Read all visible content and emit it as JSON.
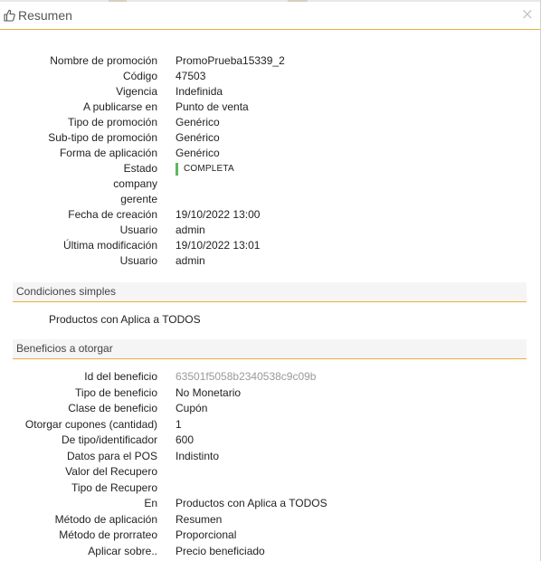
{
  "header": {
    "title": "Resumen",
    "close": "×"
  },
  "summary": [
    {
      "label": "Nombre de promoción",
      "value": "PromoPrueba15339_2"
    },
    {
      "label": "Código",
      "value": "47503"
    },
    {
      "label": "Vigencia",
      "value": "Indefinida"
    },
    {
      "label": "A publicarse en",
      "value": "Punto de venta"
    },
    {
      "label": "Tipo de promoción",
      "value": "Genérico"
    },
    {
      "label": "Sub-tipo de promoción",
      "value": "Genérico"
    },
    {
      "label": "Forma de aplicación",
      "value": "Genérico"
    },
    {
      "label": "Estado",
      "value": "COMPLETA",
      "status_color": "#5cb85c"
    },
    {
      "label": "company",
      "value": ""
    },
    {
      "label": "gerente",
      "value": ""
    },
    {
      "label": "Fecha de creación",
      "value": "19/10/2022 13:00"
    },
    {
      "label": "Usuario",
      "value": "admin"
    },
    {
      "label": "Última modificación",
      "value": "19/10/2022 13:01"
    },
    {
      "label": "Usuario",
      "value": "admin"
    }
  ],
  "conditions": {
    "title": "Condiciones simples",
    "text": "Productos con Aplica a TODOS"
  },
  "benefits": {
    "title": "Beneficios a otorgar",
    "rows": [
      {
        "label": "Id del beneficio",
        "value": "63501f5058b2340538c9c09b"
      },
      {
        "label": "Tipo de beneficio",
        "value": "No Monetario"
      },
      {
        "label": "Clase de beneficio",
        "value": "Cupón"
      },
      {
        "label": "Otorgar cupones (cantidad)",
        "value": "1"
      },
      {
        "label": "De tipo/identificador",
        "value": "600"
      },
      {
        "label": "Datos para el POS",
        "value": "Indistinto"
      },
      {
        "label": "Valor del Recupero",
        "value": ""
      },
      {
        "label": "Tipo de Recupero",
        "value": ""
      },
      {
        "label": "En",
        "value": "Productos con Aplica a TODOS"
      },
      {
        "label": "Método de aplicación",
        "value": "Resumen"
      },
      {
        "label": "Método de prorrateo",
        "value": "Proporcional"
      },
      {
        "label": "Aplicar sobre..",
        "value": "Precio beneficiado"
      }
    ]
  },
  "colors": {
    "accent": "#e6b23a",
    "status_complete": "#5cb85c"
  },
  "icons": {
    "header": "thumbs-up-icon"
  }
}
